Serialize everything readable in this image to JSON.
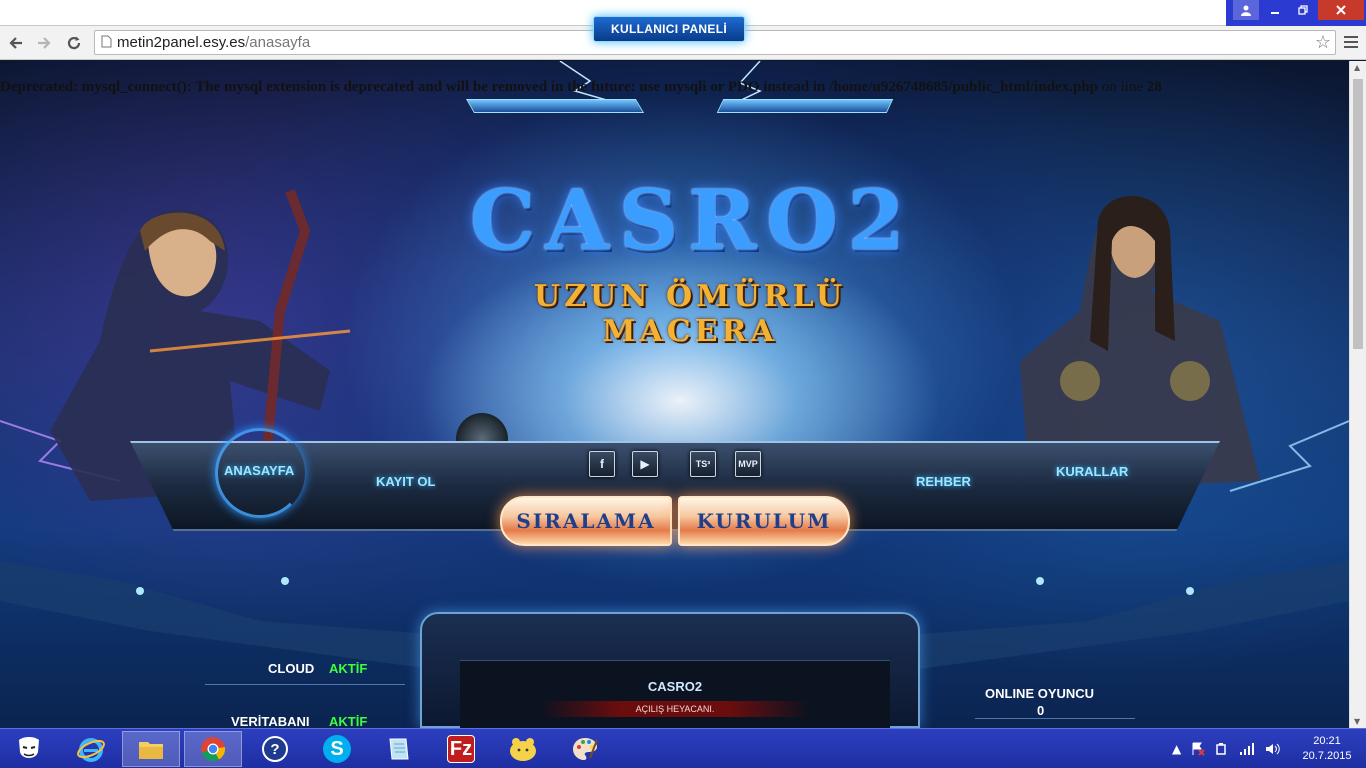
{
  "browser": {
    "url_host": "metin2panel.esy.es",
    "url_path": "/anasayfa"
  },
  "page": {
    "php_warning": {
      "prefix": "Deprecated: mysql_connect(): The mysql extension is deprecated and will be removed in the future: use mysqli or PDO instead in ",
      "path": "/home/u926748685/public_html/index.php",
      "suffix": " on line ",
      "line": "28"
    },
    "panel_link": "KULLANICI PANELİ",
    "logo": {
      "title": "CASRO2",
      "subtitle": "UZUN ÖMÜRLÜ MACERA"
    },
    "nav": {
      "home": "ANASAYFA",
      "register": "KAYIT OL",
      "guide": "REHBER",
      "rules": "KURALLAR"
    },
    "social": {
      "facebook": "f",
      "youtube": "▶",
      "ts3": "TS³",
      "mvp": "MVP"
    },
    "cta": {
      "ranking": "SIRALAMA",
      "setup": "KURULUM"
    },
    "status": {
      "cloud_label": "CLOUD",
      "cloud_value": "AKTİF",
      "db_label": "VERİTABANI",
      "db_value": "AKTİF"
    },
    "news": {
      "title": "CASRO2",
      "subtitle": "AÇILIŞ HEYACANI."
    },
    "online": {
      "label": "ONLINE OYUNCU",
      "value": "0"
    }
  },
  "taskbar": {
    "clock_time": "20:21",
    "clock_date": "20.7.2015"
  },
  "colors": {
    "accent_green": "#3cff3c",
    "nav_cyan": "#9fe6ff",
    "logo_blue": "#3a9dff",
    "logo_gold": "#f4b235",
    "taskbar_blue": "#1e2ea3"
  }
}
